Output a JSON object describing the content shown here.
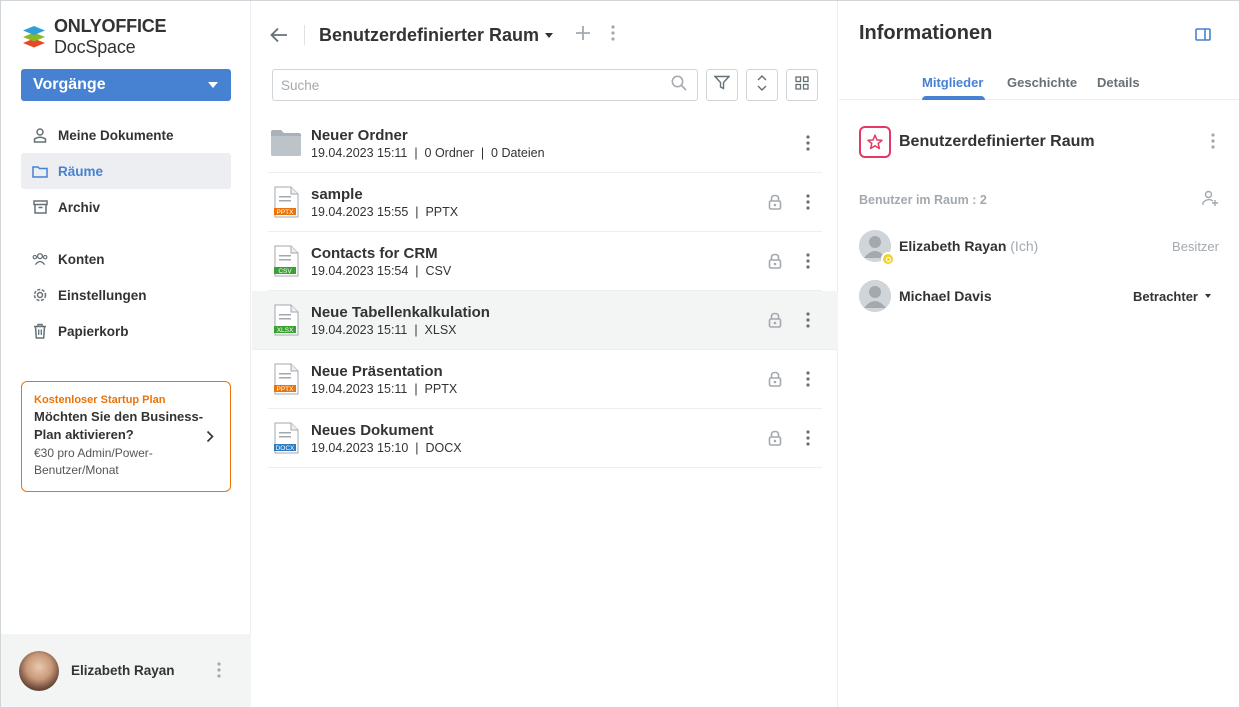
{
  "app": {
    "logo_brand": "ONLYOFFICE",
    "logo_product": "DocSpace"
  },
  "sidebar": {
    "actions_label": "Vorgänge",
    "items": [
      {
        "label": "Meine Dokumente",
        "icon": "person-icon"
      },
      {
        "label": "Räume",
        "icon": "folder-icon",
        "active": true
      },
      {
        "label": "Archiv",
        "icon": "archive-icon"
      },
      {
        "label": "Konten",
        "icon": "users-icon"
      },
      {
        "label": "Einstellungen",
        "icon": "gear-icon"
      },
      {
        "label": "Papierkorb",
        "icon": "trash-icon"
      }
    ],
    "promo": {
      "tag": "Kostenloser Startup Plan",
      "title": "Möchten Sie den Business-Plan aktivieren?",
      "subtitle": "€30 pro Admin/Power-Benutzer/Monat"
    },
    "profile": {
      "name": "Elizabeth Rayan"
    }
  },
  "main": {
    "title": "Benutzerdefinierter Raum",
    "search_placeholder": "Suche",
    "files": [
      {
        "name": "Neuer Ordner",
        "date": "19.04.2023 15:11",
        "meta": "0 Ordner",
        "meta2": "0 Dateien",
        "type": "folder"
      },
      {
        "name": "sample",
        "date": "19.04.2023 15:55",
        "meta": "PPTX",
        "type": "pptx",
        "badge": "PPTX"
      },
      {
        "name": "Contacts for CRM",
        "date": "19.04.2023 15:54",
        "meta": "CSV",
        "type": "csv",
        "badge": "CSV"
      },
      {
        "name": "Neue Tabellenkalkulation",
        "date": "19.04.2023 15:11",
        "meta": "XLSX",
        "type": "xlsx",
        "badge": "XLSX"
      },
      {
        "name": "Neue Präsentation",
        "date": "19.04.2023 15:11",
        "meta": "PPTX",
        "type": "pptx",
        "badge": "PPTX"
      },
      {
        "name": "Neues Dokument",
        "date": "19.04.2023 15:10",
        "meta": "DOCX",
        "type": "docx",
        "badge": "DOCX"
      }
    ]
  },
  "info": {
    "title": "Informationen",
    "tabs": [
      "Mitglieder",
      "Geschichte",
      "Details"
    ],
    "room_name": "Benutzerdefinierter Raum",
    "members_head": "Benutzer im Raum : 2",
    "members": [
      {
        "name": "Elizabeth Rayan",
        "me": "(Ich)",
        "role": "Besitzer"
      },
      {
        "name": "Michael Davis",
        "role": "Betrachter"
      }
    ]
  },
  "colors": {
    "accent": "#4781d1",
    "promo_border": "#ed7309",
    "room_logo": "#e53965",
    "owner_badge": "#f2d230"
  }
}
